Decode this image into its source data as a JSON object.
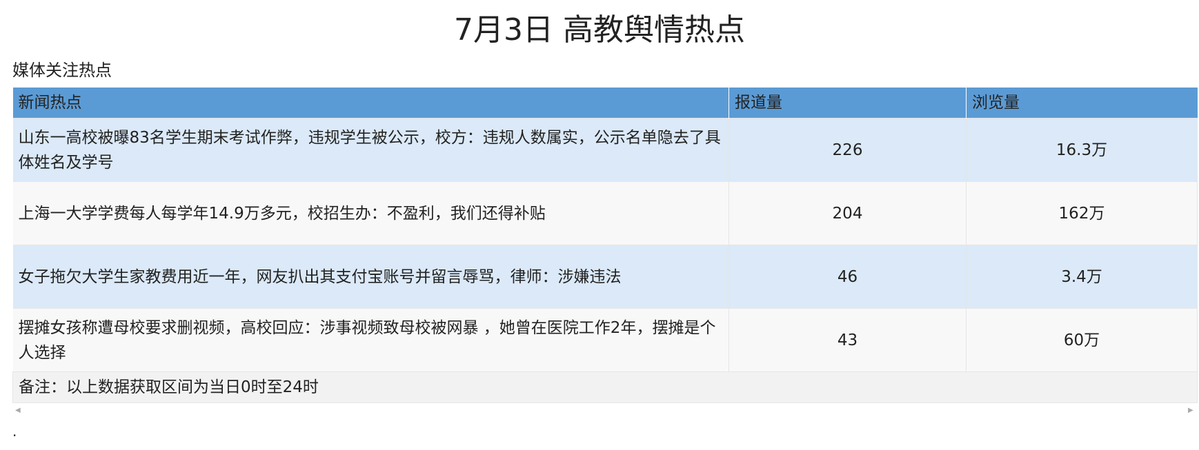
{
  "title": "7月3日 高教舆情热点",
  "section_label": "媒体关注热点",
  "table": {
    "headers": [
      "新闻热点",
      "报道量",
      "浏览量"
    ],
    "rows": [
      {
        "headline": "山东一高校被曝83名学生期末考试作弊，违规学生被公示，校方：违规人数属实，公示名单隐去了具体姓名及学号",
        "reports": "226",
        "views": "16.3万"
      },
      {
        "headline": "上海一大学学费每人每学年14.9万多元，校招生办：不盈利，我们还得补贴",
        "reports": "204",
        "views": "162万"
      },
      {
        "headline": "女子拖欠大学生家教费用近一年，网友扒出其支付宝账号并留言辱骂，律师：涉嫌违法",
        "reports": "46",
        "views": "3.4万"
      },
      {
        "headline": "摆摊女孩称遭母校要求删视频，高校回应：涉事视频致母校被网暴 ，她曾在医院工作2年，摆摊是个人选择",
        "reports": "43",
        "views": "60万"
      }
    ],
    "note": "备注：以上数据获取区间为当日0时至24时"
  },
  "trailing_text": ".",
  "colors": {
    "header_bg": "#5b9bd5",
    "row_odd_bg": "#dbe9f8",
    "row_even_bg": "#f8f8f8",
    "note_bg": "#f2f2f2"
  }
}
